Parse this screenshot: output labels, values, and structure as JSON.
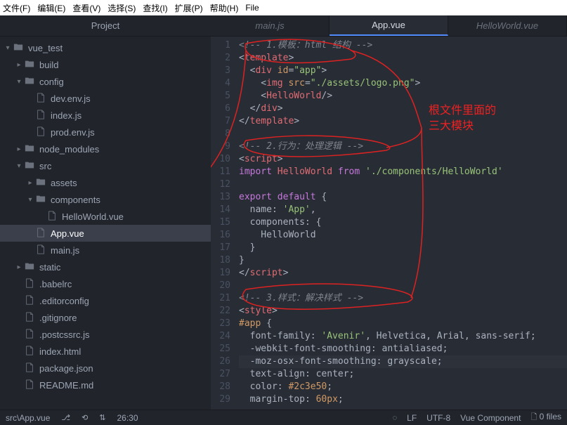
{
  "menu": [
    "文件(F)",
    "编辑(E)",
    "查看(V)",
    "选择(S)",
    "查找(I)",
    "扩展(P)",
    "帮助(H)",
    "File"
  ],
  "sidebar": {
    "title": "Project",
    "items": [
      {
        "label": "vue_test",
        "type": "folder",
        "open": true,
        "pad": 0
      },
      {
        "label": "build",
        "type": "folder",
        "open": false,
        "pad": 1
      },
      {
        "label": "config",
        "type": "folder",
        "open": true,
        "pad": 1
      },
      {
        "label": "dev.env.js",
        "type": "file",
        "pad": 2
      },
      {
        "label": "index.js",
        "type": "file",
        "pad": 2
      },
      {
        "label": "prod.env.js",
        "type": "file",
        "pad": 2
      },
      {
        "label": "node_modules",
        "type": "folder",
        "open": false,
        "pad": 1
      },
      {
        "label": "src",
        "type": "folder",
        "open": true,
        "pad": 1
      },
      {
        "label": "assets",
        "type": "folder",
        "open": false,
        "pad": 2
      },
      {
        "label": "components",
        "type": "folder",
        "open": true,
        "pad": 2
      },
      {
        "label": "HelloWorld.vue",
        "type": "file",
        "pad": 3
      },
      {
        "label": "App.vue",
        "type": "file",
        "pad": 2,
        "selected": true
      },
      {
        "label": "main.js",
        "type": "file",
        "pad": 2
      },
      {
        "label": "static",
        "type": "folder",
        "open": false,
        "pad": 1
      },
      {
        "label": ".babelrc",
        "type": "file",
        "pad": 1
      },
      {
        "label": ".editorconfig",
        "type": "file",
        "pad": 1
      },
      {
        "label": ".gitignore",
        "type": "file",
        "pad": 1
      },
      {
        "label": ".postcssrc.js",
        "type": "file",
        "pad": 1
      },
      {
        "label": "index.html",
        "type": "file",
        "pad": 1
      },
      {
        "label": "package.json",
        "type": "file",
        "pad": 1
      },
      {
        "label": "README.md",
        "type": "file",
        "pad": 1
      }
    ]
  },
  "tabs": [
    {
      "label": "main.js",
      "active": false
    },
    {
      "label": "App.vue",
      "active": true
    },
    {
      "label": "HelloWorld.vue",
      "active": false
    }
  ],
  "code": {
    "lines": [
      {
        "n": 1,
        "t": "comment",
        "text": "<!-- 1.模板：html 结构 -->"
      },
      {
        "n": 2,
        "html": "&lt;<span class='c-tag'>template</span>&gt;"
      },
      {
        "n": 3,
        "html": "  &lt;<span class='c-tag'>div</span> <span class='c-attr'>id</span>=<span class='c-str'>\"app\"</span>&gt;"
      },
      {
        "n": 4,
        "html": "    &lt;<span class='c-tag'>img</span> <span class='c-attr'>src</span>=<span class='c-str'>\"./assets/logo.png\"</span>&gt;"
      },
      {
        "n": 5,
        "html": "    &lt;<span class='c-tag'>HelloWorld</span>/&gt;"
      },
      {
        "n": 6,
        "html": "  &lt;/<span class='c-tag'>div</span>&gt;"
      },
      {
        "n": 7,
        "html": "&lt;/<span class='c-tag'>template</span>&gt;"
      },
      {
        "n": 8,
        "html": ""
      },
      {
        "n": 9,
        "t": "comment",
        "text": "<!-- 2.行为：处理逻辑 -->"
      },
      {
        "n": 10,
        "html": "&lt;<span class='c-tag'>script</span>&gt;"
      },
      {
        "n": 11,
        "html": "<span class='c-kw'>import</span> <span class='c-name'>HelloWorld</span> <span class='c-kw'>from</span> <span class='c-str'>'./components/HelloWorld'</span>"
      },
      {
        "n": 12,
        "html": ""
      },
      {
        "n": 13,
        "html": "<span class='c-kw'>export</span> <span class='c-kw'>default</span> {"
      },
      {
        "n": 14,
        "html": "  name: <span class='c-str'>'App'</span>,"
      },
      {
        "n": 15,
        "html": "  components: {"
      },
      {
        "n": 16,
        "html": "    HelloWorld"
      },
      {
        "n": 17,
        "html": "  }"
      },
      {
        "n": 18,
        "html": "}"
      },
      {
        "n": 19,
        "html": "&lt;/<span class='c-tag'>script</span>&gt;"
      },
      {
        "n": 20,
        "html": ""
      },
      {
        "n": 21,
        "t": "comment",
        "text": "<!-- 3.样式：解决样式 -->"
      },
      {
        "n": 22,
        "html": "&lt;<span class='c-tag'>style</span>&gt;"
      },
      {
        "n": 23,
        "html": "<span class='c-sel'>#app</span> {"
      },
      {
        "n": 24,
        "html": "  <span class='c-prop'>font-family</span>: <span class='c-str'>'Avenir'</span>, Helvetica, Arial, sans-serif;"
      },
      {
        "n": 25,
        "html": "  <span class='c-prop'>-webkit-font-smoothing</span>: antialiased;"
      },
      {
        "n": 26,
        "hl": true,
        "html": "  <span class='c-prop'>-moz-osx-font-smoothing</span>: grayscale;"
      },
      {
        "n": 27,
        "html": "  <span class='c-prop'>text-align</span>: center;"
      },
      {
        "n": 28,
        "html": "  <span class='c-prop'>color</span>: <span class='c-num'>#2c3e50</span>;"
      },
      {
        "n": 29,
        "html": "  <span class='c-prop'>margin-top</span>: <span class='c-num'>60px</span>;"
      }
    ]
  },
  "annotation": {
    "line1": "根文件里面的",
    "line2": "三大模块"
  },
  "status": {
    "path": "src\\App.vue",
    "cursor": "26:30",
    "lf": "LF",
    "encoding": "UTF-8",
    "lang": "Vue Component",
    "files": "0 files"
  }
}
